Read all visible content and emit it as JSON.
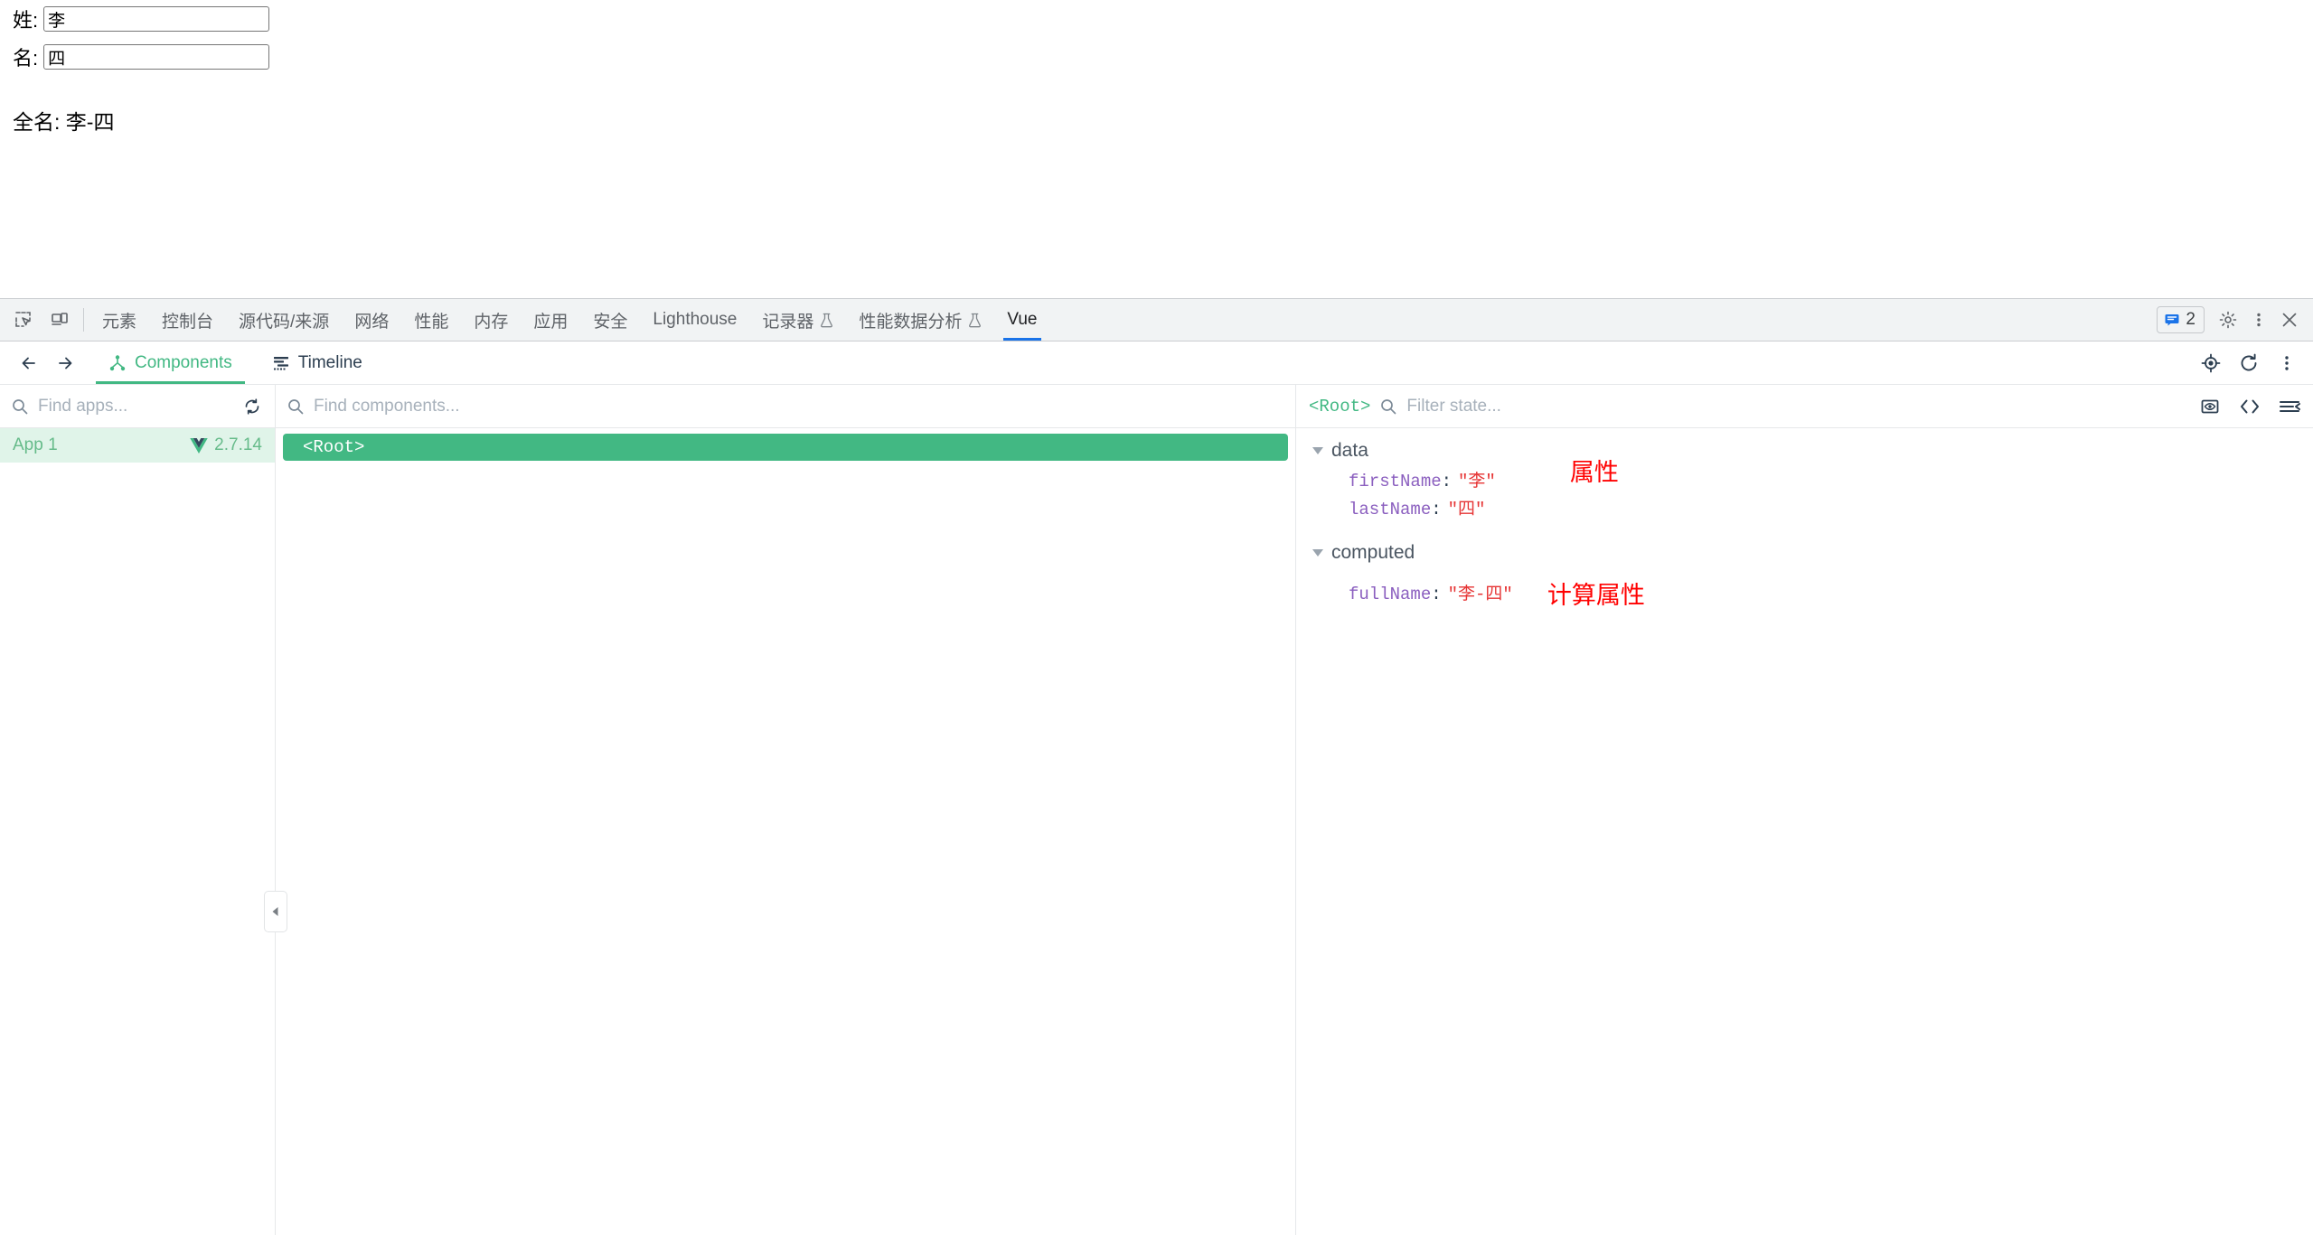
{
  "page": {
    "fields": [
      {
        "label": "姓:",
        "value": "李",
        "name": "first-name-input"
      },
      {
        "label": "名:",
        "value": "四",
        "name": "last-name-input"
      }
    ],
    "full_name_line": "全名: 李-四"
  },
  "devtools": {
    "left_icons": [
      {
        "name": "inspect-element-icon",
        "title": "检查元素"
      },
      {
        "name": "device-toolbar-icon",
        "title": "切换设备工具栏"
      }
    ],
    "tabs": [
      {
        "label": "元素",
        "active": false,
        "flask": false
      },
      {
        "label": "控制台",
        "active": false,
        "flask": false
      },
      {
        "label": "源代码/来源",
        "active": false,
        "flask": false
      },
      {
        "label": "网络",
        "active": false,
        "flask": false
      },
      {
        "label": "性能",
        "active": false,
        "flask": false
      },
      {
        "label": "内存",
        "active": false,
        "flask": false
      },
      {
        "label": "应用",
        "active": false,
        "flask": false
      },
      {
        "label": "安全",
        "active": false,
        "flask": false
      },
      {
        "label": "Lighthouse",
        "active": false,
        "flask": false
      },
      {
        "label": "记录器",
        "active": false,
        "flask": true
      },
      {
        "label": "性能数据分析",
        "active": false,
        "flask": true
      },
      {
        "label": "Vue",
        "active": true,
        "flask": false
      }
    ],
    "message_badge_count": "2",
    "right_icons": [
      {
        "name": "settings-gear-icon"
      },
      {
        "name": "more-options-kebab-icon"
      },
      {
        "name": "close-devtools-icon"
      }
    ],
    "accent_color": "#1a73e8"
  },
  "vue": {
    "accent_color": "#42b883",
    "nav": {
      "back": "←",
      "forward": "→"
    },
    "tabs": [
      {
        "label": "Components",
        "icon": "component-tree-icon",
        "active": true
      },
      {
        "label": "Timeline",
        "icon": "timeline-icon",
        "active": false
      }
    ],
    "topbar_icons": [
      {
        "name": "select-component-target-icon"
      },
      {
        "name": "refresh-icon"
      },
      {
        "name": "more-options-kebab-icon"
      }
    ],
    "apps_pane": {
      "search_placeholder": "Find apps...",
      "search_value": "",
      "refresh_icon": "refresh-apps-icon",
      "items": [
        {
          "name": "App 1",
          "version": "2.7.14",
          "selected": true,
          "logo": "vue-logo-icon"
        }
      ]
    },
    "tree_pane": {
      "search_placeholder": "Find components...",
      "search_value": "",
      "nodes": [
        {
          "label": "<Root>",
          "selected": true
        }
      ],
      "collapse_handle_icon": "collapse-left-arrow-icon"
    },
    "state_pane": {
      "component_label": "<Root>",
      "filter_placeholder": "Filter state...",
      "filter_value": "",
      "icons": [
        {
          "name": "inspect-dom-eye-icon"
        },
        {
          "name": "open-in-editor-code-icon"
        },
        {
          "name": "collapse-all-icon"
        }
      ],
      "groups": [
        {
          "name": "data",
          "expanded": true,
          "entries": [
            {
              "key": "firstName",
              "value": "\"李\""
            },
            {
              "key": "lastName",
              "value": "\"四\""
            }
          ],
          "annotation": "属性"
        },
        {
          "name": "computed",
          "expanded": true,
          "entries": [
            {
              "key": "fullName",
              "value": "\"李-四\""
            }
          ],
          "annotation": "计算属性"
        }
      ]
    }
  }
}
